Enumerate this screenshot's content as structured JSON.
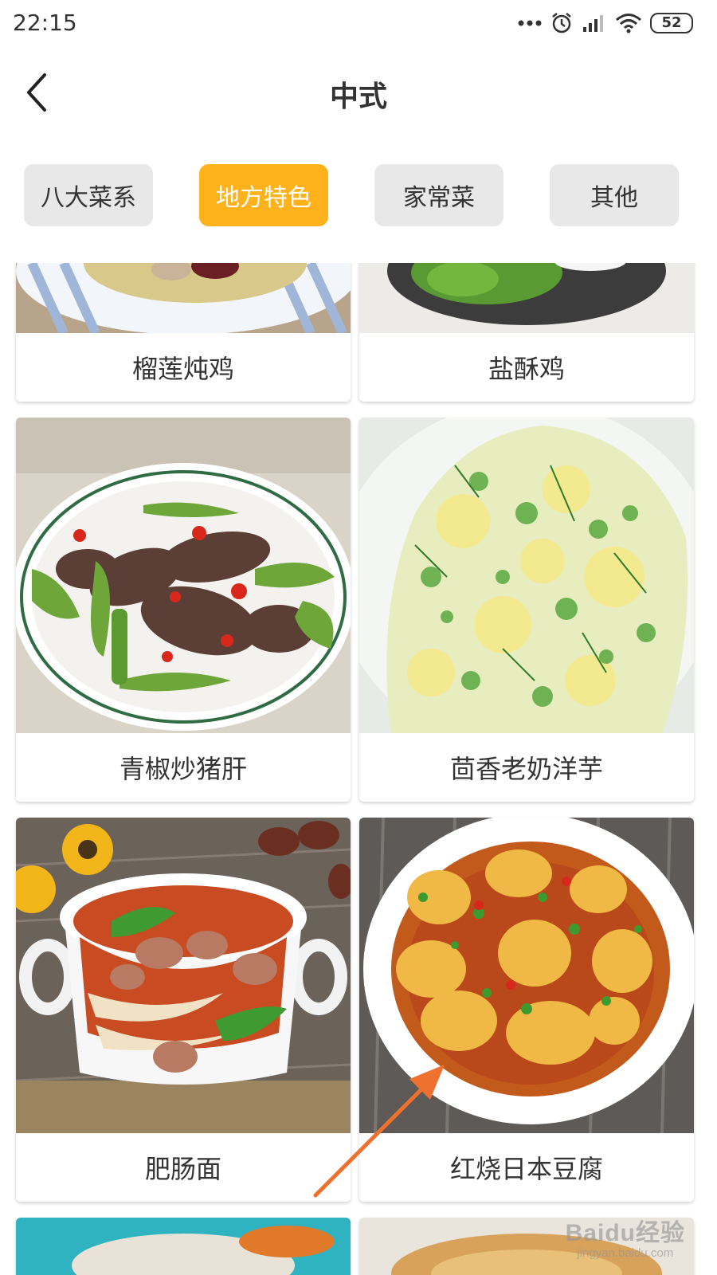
{
  "status_bar": {
    "time": "22:15",
    "battery": "52",
    "icons": [
      "more-dots-icon",
      "alarm-icon",
      "signal-icon",
      "wifi-icon",
      "battery-icon"
    ]
  },
  "header": {
    "back_icon": "chevron-left-icon",
    "title": "中式"
  },
  "tabs": [
    {
      "label": "八大菜系",
      "active": false
    },
    {
      "label": "地方特色",
      "active": true
    },
    {
      "label": "家常菜",
      "active": false
    },
    {
      "label": "其他",
      "active": false
    }
  ],
  "dishes": [
    {
      "name": "榴莲炖鸡"
    },
    {
      "name": "盐酥鸡"
    },
    {
      "name": "青椒炒猪肝"
    },
    {
      "name": "茴香老奶洋芋"
    },
    {
      "name": "肥肠面"
    },
    {
      "name": "红烧日本豆腐"
    }
  ],
  "watermark": {
    "logo": "Baidu经验",
    "url": "jingyan.baidu.com"
  },
  "colors": {
    "accent": "#ffb21c",
    "tab_inactive": "#e8e8e8",
    "annotation_arrow": "#f07030"
  }
}
